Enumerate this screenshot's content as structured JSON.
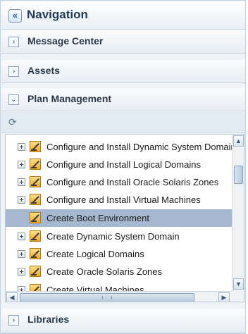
{
  "navigation": {
    "title": "Navigation",
    "collapse_glyph": "«"
  },
  "sections": [
    {
      "label": "Message Center",
      "state": "collapsed",
      "toggle_glyph": "›"
    },
    {
      "label": "Assets",
      "state": "collapsed",
      "toggle_glyph": "›"
    },
    {
      "label": "Plan Management",
      "state": "expanded",
      "toggle_glyph": "⌄"
    },
    {
      "label": "Libraries",
      "state": "collapsed",
      "toggle_glyph": "›"
    }
  ],
  "toolbar": {
    "refresh_icon": "refresh-icon",
    "refresh_glyph": "⟳"
  },
  "tree": {
    "rows": [
      {
        "label": "Configure and Install Dynamic System Domains",
        "expandable": true,
        "selected": false
      },
      {
        "label": "Configure and Install Logical Domains",
        "expandable": true,
        "selected": false
      },
      {
        "label": "Configure and Install Oracle Solaris Zones",
        "expandable": true,
        "selected": false
      },
      {
        "label": "Configure and Install Virtual Machines",
        "expandable": true,
        "selected": false
      },
      {
        "label": "Create Boot Environment",
        "expandable": false,
        "selected": true
      },
      {
        "label": "Create Dynamic System Domain",
        "expandable": true,
        "selected": false
      },
      {
        "label": "Create Logical Domains",
        "expandable": true,
        "selected": false
      },
      {
        "label": "Create Oracle Solaris Zones",
        "expandable": true,
        "selected": false
      },
      {
        "label": "Create Virtual Machines",
        "expandable": true,
        "selected": false
      }
    ],
    "scroll": {
      "up_glyph": "▲",
      "down_glyph": "▼",
      "left_glyph": "◀",
      "right_glyph": "▶"
    }
  },
  "colors": {
    "selected_row": "#a5b8cf",
    "panel_bg": "#eef3f7",
    "title_text": "#1f3a56"
  }
}
